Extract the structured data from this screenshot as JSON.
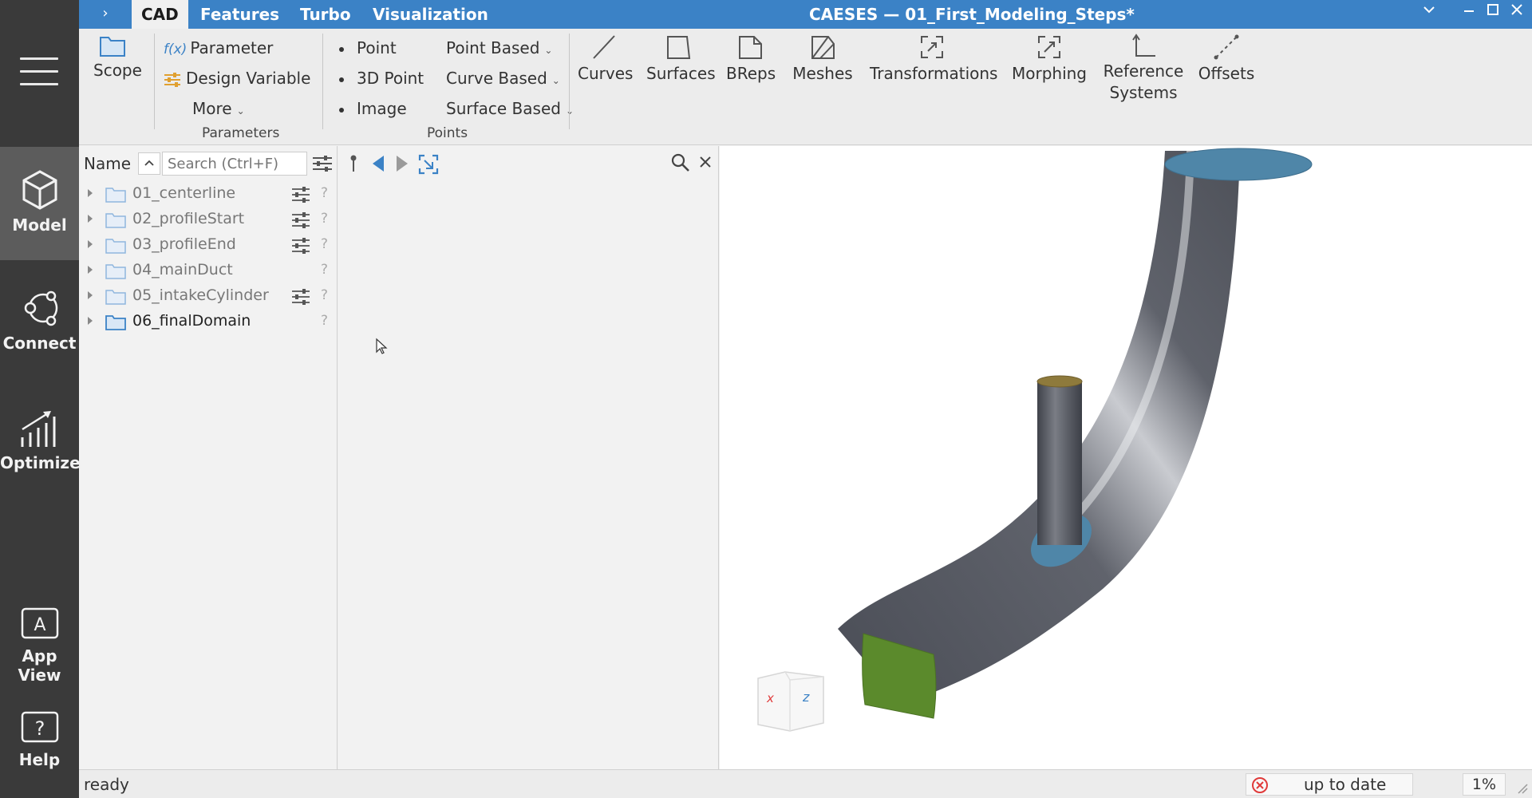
{
  "app": {
    "title": "CAESES — 01_First_Modeling_Steps*"
  },
  "titlebar": {
    "tabs": [
      {
        "label": "CAD",
        "active": true
      },
      {
        "label": "Features",
        "active": false
      },
      {
        "label": "Turbo",
        "active": false
      },
      {
        "label": "Visualization",
        "active": false
      }
    ],
    "expand_glyph": "›"
  },
  "sidebar": {
    "items": [
      {
        "label": "Model",
        "icon": "cube-icon",
        "active": true
      },
      {
        "label": "Connect",
        "icon": "connect-icon",
        "active": false
      },
      {
        "label": "Optimize",
        "icon": "optimize-icon",
        "active": false
      },
      {
        "label": "App View",
        "icon": "app-view-icon",
        "active": false
      },
      {
        "label": "Help",
        "icon": "help-icon",
        "active": false
      }
    ]
  },
  "ribbon": {
    "scope": "Scope",
    "parameters": {
      "parameter": "Parameter",
      "parameter_prefix": "f(x)",
      "design_variable": "Design Variable",
      "more": "More",
      "group_label": "Parameters"
    },
    "points": {
      "point": "Point",
      "point3d": "3D Point",
      "image": "Image",
      "point_based": "Point Based",
      "curve_based": "Curve Based",
      "surface_based": "Surface Based",
      "group_label": "Points"
    },
    "tools": {
      "curves": "Curves",
      "surfaces": "Surfaces",
      "breps": "BReps",
      "meshes": "Meshes",
      "transformations": "Transformations",
      "morphing": "Morphing",
      "reference_line1": "Reference",
      "reference_line2": "Systems",
      "offsets": "Offsets"
    }
  },
  "tree": {
    "header_label": "Name",
    "search_placeholder": "Search (Ctrl+F)",
    "rows": [
      {
        "label": "01_centerline",
        "has_sliders": true
      },
      {
        "label": "02_profileStart",
        "has_sliders": true
      },
      {
        "label": "03_profileEnd",
        "has_sliders": true
      },
      {
        "label": "04_mainDuct",
        "has_sliders": false
      },
      {
        "label": "05_intakeCylinder",
        "has_sliders": true
      },
      {
        "label": "06_finalDomain",
        "has_sliders": false
      }
    ],
    "help_glyph": "?"
  },
  "viewcube": {
    "x_label": "x",
    "z_label": "z"
  },
  "status": {
    "text": "ready",
    "sync": "up to date",
    "zoom": "1%"
  },
  "colors": {
    "titlebar": "#3b82c6",
    "sidebar": "#3a3a3a",
    "duct_body": "#5a5d66",
    "duct_inlet": "#4f86a8",
    "duct_outlet": "#5b8a2c",
    "intake_cap": "#8e7a3c",
    "error_red": "#e03a3a"
  }
}
